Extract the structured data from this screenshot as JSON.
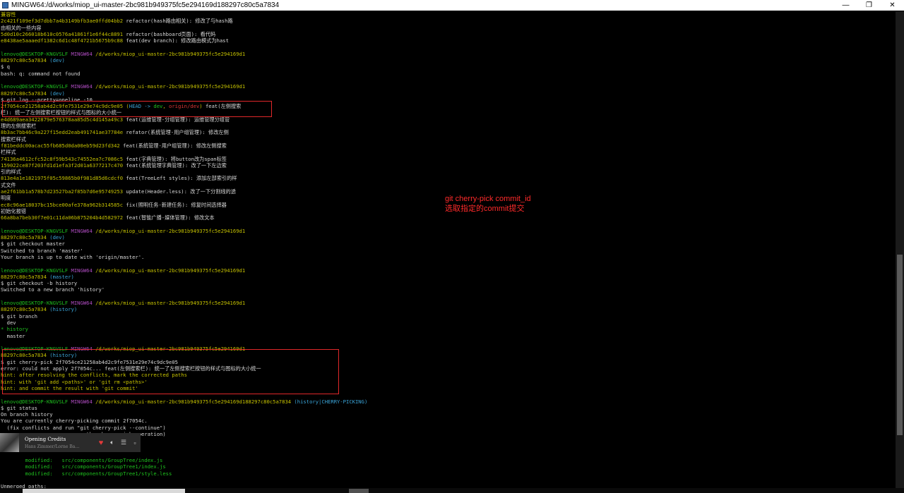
{
  "window": {
    "title": "MINGW64:/d/works/miop_ui-master-2bc981b949375fc5e294169d188297c80c5a7834",
    "minimize_glyph": "—",
    "maximize_glyph": "❐",
    "close_glyph": "✕"
  },
  "terminal_lines": [
    [
      {
        "t": "兼容性",
        "c": "yellow"
      }
    ],
    [
      {
        "t": "2c421f109ef3d7dbb7a4b3149bfb3ae0ffd04bb2",
        "c": "yellow"
      },
      {
        "t": " refactor(hash路由相关): 修改了与hash路",
        "c": "white"
      }
    ],
    [
      {
        "t": "由相关的一些内容",
        "c": "white"
      }
    ],
    [
      {
        "t": "5d0d10c266018b610c0576a41861f1e6f44c8891",
        "c": "yellow"
      },
      {
        "t": " refactor(bashboard页面): 看代码",
        "c": "white"
      }
    ],
    [
      {
        "t": "e8438ae5aaaedf1382c6d1c48f4721b5675b9c88",
        "c": "yellow"
      },
      {
        "t": " feat(dev branch): 修改路由模式为hast",
        "c": "white"
      }
    ],
    [
      {
        "t": "",
        "c": "white"
      }
    ],
    [
      {
        "t": "lenovo@DESKTOP-KNGVSLF ",
        "c": "green"
      },
      {
        "t": "MINGW64 ",
        "c": "purple"
      },
      {
        "t": "/d/works/miop_ui-master-2bc981b949375fc5e294169d1",
        "c": "yellow"
      }
    ],
    [
      {
        "t": "88297c80c5a7834",
        "c": "yellow"
      },
      {
        "t": " (dev)",
        "c": "cyan"
      }
    ],
    [
      {
        "t": "$ q",
        "c": "white"
      }
    ],
    [
      {
        "t": "bash: q: command not found",
        "c": "white"
      }
    ],
    [
      {
        "t": "",
        "c": "white"
      }
    ],
    [
      {
        "t": "lenovo@DESKTOP-KNGVSLF ",
        "c": "green"
      },
      {
        "t": "MINGW64 ",
        "c": "purple"
      },
      {
        "t": "/d/works/miop_ui-master-2bc981b949375fc5e294169d1",
        "c": "yellow"
      }
    ],
    [
      {
        "t": "88297c80c5a7834",
        "c": "yellow"
      },
      {
        "t": " (dev)",
        "c": "cyan"
      }
    ],
    [
      {
        "t": "$ git log --pretty=oneline -10",
        "c": "white"
      }
    ],
    [
      {
        "t": "2f7054ce21258ab4d2c9fe7531e29e74c9dc9e05",
        "c": "yellow"
      },
      {
        "t": " (",
        "c": "yellow"
      },
      {
        "t": "HEAD -> ",
        "c": "cyan"
      },
      {
        "t": "dev",
        "c": "green"
      },
      {
        "t": ", ",
        "c": "yellow"
      },
      {
        "t": "origin/dev",
        "c": "red"
      },
      {
        "t": ")",
        "c": "yellow"
      },
      {
        "t": " feat(左侧搜索",
        "c": "white"
      }
    ],
    [
      {
        "t": "栏): 统一了左侧搜索栏按钮的样式与图标的大小统一",
        "c": "white"
      }
    ],
    [
      {
        "t": "e4d689aea3422879e576378aa85d5c4d145a49c3",
        "c": "yellow"
      },
      {
        "t": " feat(运维管理-分组管理): 运维管理分组管",
        "c": "white"
      }
    ],
    [
      {
        "t": "理的左侧搜索栏",
        "c": "white"
      }
    ],
    [
      {
        "t": "8b3ac7bb46c9a227f15edd2eab491741ae37784e",
        "c": "yellow"
      },
      {
        "t": " refator(系统管理-用户组管理): 修改左侧",
        "c": "white"
      }
    ],
    [
      {
        "t": "搜索栏样式",
        "c": "white"
      }
    ],
    [
      {
        "t": "f81beddc00acac55fb685d0da00eb59d23fd342",
        "c": "yellow"
      },
      {
        "t": " feat(系统管理-用户组管理): 修改左侧搜索",
        "c": "white"
      }
    ],
    [
      {
        "t": "栏样式",
        "c": "white"
      }
    ],
    [
      {
        "t": "74136a4612cfc52c8f59b543c74552ea7c7086c5",
        "c": "yellow"
      },
      {
        "t": " feat(字典管理): 将button改为span标签",
        "c": "white"
      }
    ],
    [
      {
        "t": "159022ce87f203fd1d1efa3f2d01a6377217c470",
        "c": "yellow"
      },
      {
        "t": " feat(系统管理字典管理): 改了一下左边索",
        "c": "white"
      }
    ],
    [
      {
        "t": "引的样式",
        "c": "white"
      }
    ],
    [
      {
        "t": "813e4a1e1821975f05c59865b0f981d85d6cdcf0",
        "c": "yellow"
      },
      {
        "t": " feat(TreeLeft styles): 添加左部索引的样",
        "c": "white"
      }
    ],
    [
      {
        "t": "式文件",
        "c": "white"
      }
    ],
    [
      {
        "t": "ae2f61bb1a578b7d23527ba2f85b7d6e95749253",
        "c": "yellow"
      },
      {
        "t": " update(Header.less): 改了一下分割线的透",
        "c": "white"
      }
    ],
    [
      {
        "t": "明度",
        "c": "white"
      }
    ],
    [
      {
        "t": "ec8c96ae18037bc15bce00afe378a962b314585c",
        "c": "yellow"
      },
      {
        "t": " fix(照明任务-新建任务): 修复时间选择器",
        "c": "white"
      }
    ],
    [
      {
        "t": "初始化报错",
        "c": "white"
      }
    ],
    [
      {
        "t": "66a8ba7beb30f7e01c11da06b875204b4d582972",
        "c": "yellow"
      },
      {
        "t": " feat(智能广播-媒体管理): 修改文本",
        "c": "white"
      }
    ],
    [
      {
        "t": "",
        "c": "white"
      }
    ],
    [
      {
        "t": "lenovo@DESKTOP-KNGVSLF ",
        "c": "green"
      },
      {
        "t": "MINGW64 ",
        "c": "purple"
      },
      {
        "t": "/d/works/miop_ui-master-2bc981b949375fc5e294169d1",
        "c": "yellow"
      }
    ],
    [
      {
        "t": "88297c80c5a7834",
        "c": "yellow"
      },
      {
        "t": " (dev)",
        "c": "cyan"
      }
    ],
    [
      {
        "t": "$ git checkout master",
        "c": "white"
      }
    ],
    [
      {
        "t": "Switched to branch 'master'",
        "c": "white"
      }
    ],
    [
      {
        "t": "Your branch is up to date with 'origin/master'.",
        "c": "white"
      }
    ],
    [
      {
        "t": "",
        "c": "white"
      }
    ],
    [
      {
        "t": "lenovo@DESKTOP-KNGVSLF ",
        "c": "green"
      },
      {
        "t": "MINGW64 ",
        "c": "purple"
      },
      {
        "t": "/d/works/miop_ui-master-2bc981b949375fc5e294169d1",
        "c": "yellow"
      }
    ],
    [
      {
        "t": "88297c80c5a7834",
        "c": "yellow"
      },
      {
        "t": " (master)",
        "c": "cyan"
      }
    ],
    [
      {
        "t": "$ git checkout -b history",
        "c": "white"
      }
    ],
    [
      {
        "t": "Switched to a new branch 'history'",
        "c": "white"
      }
    ],
    [
      {
        "t": "",
        "c": "white"
      }
    ],
    [
      {
        "t": "lenovo@DESKTOP-KNGVSLF ",
        "c": "green"
      },
      {
        "t": "MINGW64 ",
        "c": "purple"
      },
      {
        "t": "/d/works/miop_ui-master-2bc981b949375fc5e294169d1",
        "c": "yellow"
      }
    ],
    [
      {
        "t": "88297c80c5a7834",
        "c": "yellow"
      },
      {
        "t": " (history)",
        "c": "cyan"
      }
    ],
    [
      {
        "t": "$ git branch",
        "c": "white"
      }
    ],
    [
      {
        "t": "  dev",
        "c": "white"
      }
    ],
    [
      {
        "t": "* history",
        "c": "green"
      }
    ],
    [
      {
        "t": "  master",
        "c": "white"
      }
    ],
    [
      {
        "t": "",
        "c": "white"
      }
    ],
    [
      {
        "t": "lenovo@DESKTOP-KNGVSLF ",
        "c": "green"
      },
      {
        "t": "MINGW64 ",
        "c": "purple"
      },
      {
        "t": "/d/works/miop_ui-master-2bc981b949375fc5e294169d1",
        "c": "yellow"
      }
    ],
    [
      {
        "t": "88297c80c5a7834",
        "c": "yellow"
      },
      {
        "t": " (history)",
        "c": "cyan"
      }
    ],
    [
      {
        "t": "$ git cherry-pick 2f7054ce21258ab4d2c9fe7531e29e74c9dc9e05",
        "c": "white"
      }
    ],
    [
      {
        "t": "error: could not apply 2f7054c... feat(左侧搜索栏): 统一了左侧搜索栏按钮的样式与图标的大小统一",
        "c": "white"
      }
    ],
    [
      {
        "t": "hint: after resolving the conflicts, mark the corrected paths",
        "c": "yellow"
      }
    ],
    [
      {
        "t": "hint: with 'git add <paths>' or 'git rm <paths>'",
        "c": "yellow"
      }
    ],
    [
      {
        "t": "hint: and commit the result with 'git commit'",
        "c": "yellow"
      }
    ],
    [
      {
        "t": "",
        "c": "white"
      }
    ],
    [
      {
        "t": "lenovo@DESKTOP-KNGVSLF ",
        "c": "green"
      },
      {
        "t": "MINGW64 ",
        "c": "purple"
      },
      {
        "t": "/d/works/miop_ui-master-2bc981b949375fc5e294169d188297c80c5a7834",
        "c": "yellow"
      },
      {
        "t": " (history|CHERRY-PICKING)",
        "c": "cyan"
      }
    ],
    [
      {
        "t": "$ git status",
        "c": "white"
      }
    ],
    [
      {
        "t": "On branch history",
        "c": "white"
      }
    ],
    [
      {
        "t": "You are currently cherry-picking commit 2f7054c.",
        "c": "white"
      }
    ],
    [
      {
        "t": "  (fix conflicts and run \"git cherry-pick --continue\")",
        "c": "white"
      }
    ],
    [
      {
        "t": "                            the cherry-pick operation)",
        "c": "white"
      }
    ],
    [
      {
        "t": "",
        "c": "white"
      }
    ],
    [
      {
        "t": "",
        "c": "white"
      }
    ],
    [
      {
        "t": "",
        "c": "white"
      }
    ],
    [
      {
        "t": "        modified:   src/components/GroupTree/index.js",
        "c": "green"
      }
    ],
    [
      {
        "t": "        modified:   src/components/GroupTree1/index.js",
        "c": "green"
      }
    ],
    [
      {
        "t": "        modified:   src/components/GroupTree1/style.less",
        "c": "green"
      }
    ],
    [
      {
        "t": "",
        "c": "white"
      }
    ],
    [
      {
        "t": "Unmerged paths:",
        "c": "white"
      }
    ]
  ],
  "annotation": {
    "line1": "git cherry-pick commit_id",
    "line2": "选取指定的commit提交"
  },
  "mini_player": {
    "song": "Opening Credits",
    "artist": "Hans Zimmer/Lorne Ba…",
    "icons": [
      "heart-icon",
      "volume-icon",
      "playlist-icon",
      "expand-icon"
    ]
  },
  "colors": {
    "green": "#1fc21f",
    "purple": "#b04cc2",
    "yellow": "#c6c200",
    "cyan": "#3aa4d8",
    "red": "#d93535",
    "white": "#d8d8d8",
    "annotation_red": "#ff2a2a"
  }
}
